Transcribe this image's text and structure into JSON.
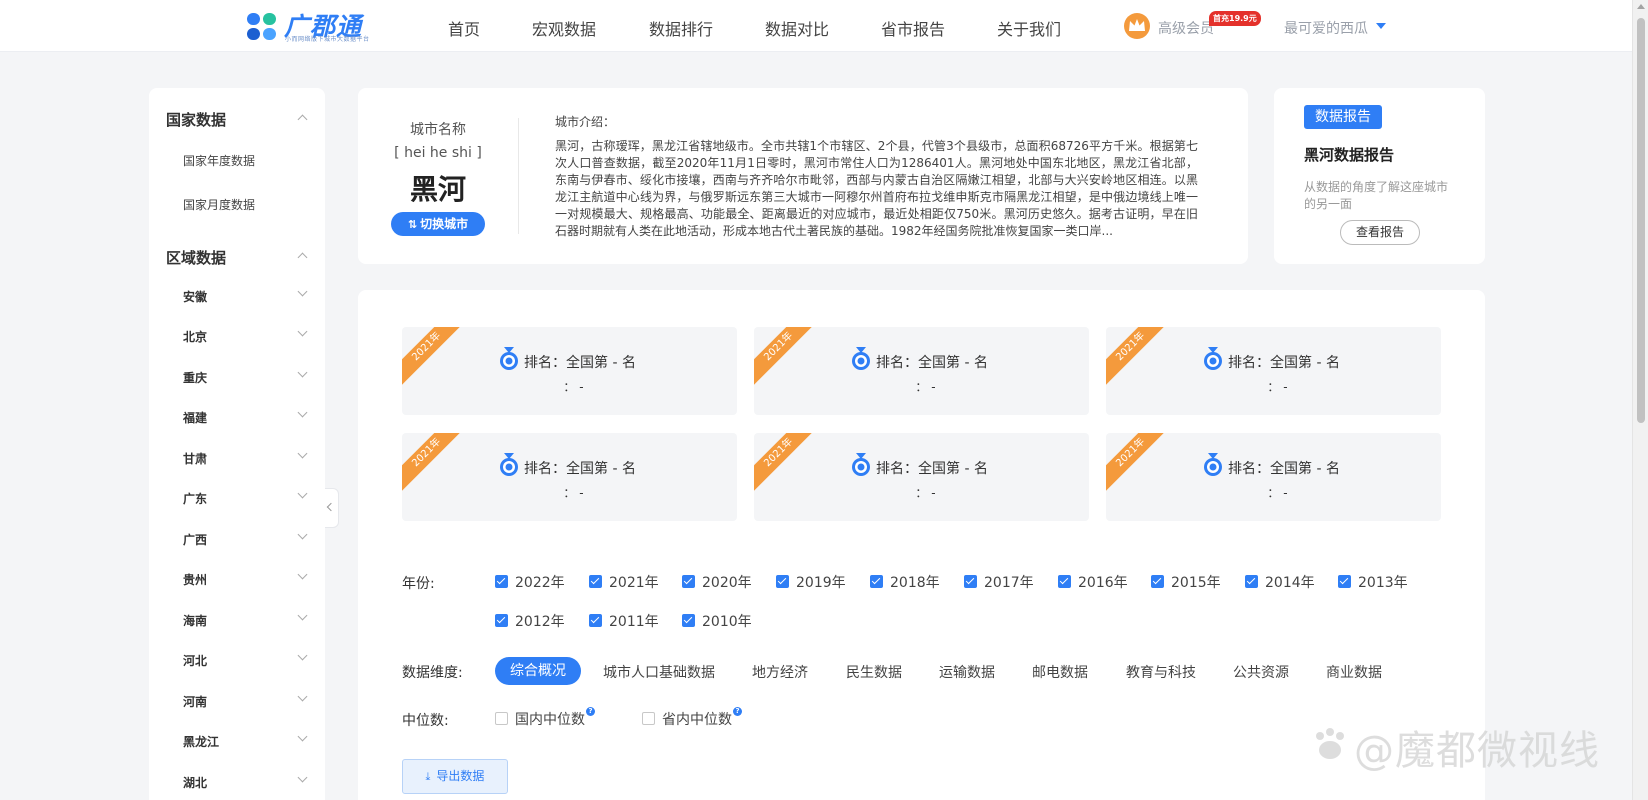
{
  "header": {
    "logo_text": "广郡通",
    "logo_sub": "小而网络版下城市大数据平台",
    "nav": [
      "首页",
      "宏观数据",
      "数据排行",
      "数据对比",
      "省市报告",
      "关于我们"
    ],
    "member_label": "高级会员",
    "promo_badge": "首充19.9元",
    "user_name": "最可爱的西瓜"
  },
  "sidebar": {
    "national_title": "国家数据",
    "national_items": [
      "国家年度数据",
      "国家月度数据"
    ],
    "regional_title": "区域数据",
    "provinces": [
      "安徽",
      "北京",
      "重庆",
      "福建",
      "甘肃",
      "广东",
      "广西",
      "贵州",
      "海南",
      "河北",
      "河南",
      "黑龙江",
      "湖北"
    ]
  },
  "city": {
    "label": "城市名称",
    "pinyin": "[ hei he shi ]",
    "name": "黑河",
    "switch_label": "切换城市",
    "intro_label": "城市介绍：",
    "intro_text": "黑河，古称瑷珲，黑龙江省辖地级市。全市共辖1个市辖区、2个县，代管3个县级市，总面积68726平方千米。根据第七次人口普查数据，截至2020年11月1日零时，黑河市常住人口为1286401人。黑河地处中国东北地区，黑龙江省北部，东南与伊春市、绥化市接壤，西南与齐齐哈尔市毗邻，西部与内蒙古自治区隔嫩江相望，北部与大兴安岭地区相连。以黑龙江主航道中心线为界，与俄罗斯远东第三大城市一阿穆尔州首府布拉戈维申斯克市隔黑龙江相望，是中俄边境线上唯一一对规模最大、规格最高、功能最全、距离最近的对应城市，最近处相距仅750米。黑河历史悠久。据考古证明，早在旧石器时期就有人类在此地活动，形成本地古代土著民族的基础。1982年经国务院批准恢复国家一类口岸..."
  },
  "report": {
    "tag": "数据报告",
    "title": "黑河数据报告",
    "desc": "从数据的角度了解这座城市的另一面",
    "button": "查看报告"
  },
  "rank_cards": [
    {
      "year": "2021年",
      "text": "排名：全国第 - 名",
      "sub": "： -"
    },
    {
      "year": "2021年",
      "text": "排名：全国第 - 名",
      "sub": "： -"
    },
    {
      "year": "2021年",
      "text": "排名：全国第 - 名",
      "sub": "： -"
    },
    {
      "year": "2021年",
      "text": "排名：全国第 - 名",
      "sub": "： -"
    },
    {
      "year": "2021年",
      "text": "排名：全国第 - 名",
      "sub": "： -"
    },
    {
      "year": "2021年",
      "text": "排名：全国第 - 名",
      "sub": "： -"
    }
  ],
  "filters": {
    "year_label": "年份:",
    "years": [
      "2022年",
      "2021年",
      "2020年",
      "2019年",
      "2018年",
      "2017年",
      "2016年",
      "2015年",
      "2014年",
      "2013年",
      "2012年",
      "2011年",
      "2010年"
    ],
    "dimension_label": "数据维度:",
    "dimensions": [
      "综合概况",
      "城市人口基础数据",
      "地方经济",
      "民生数据",
      "运输数据",
      "邮电数据",
      "教育与科技",
      "公共资源",
      "商业数据"
    ],
    "median_label": "中位数:",
    "medians": [
      "国内中位数",
      "省内中位数"
    ],
    "export_label": "导出数据"
  },
  "watermark": "@魔都微视线",
  "colors": {
    "primary": "#2f7ef5",
    "ribbon": "#f49a3c",
    "badge": "#e4312b"
  }
}
